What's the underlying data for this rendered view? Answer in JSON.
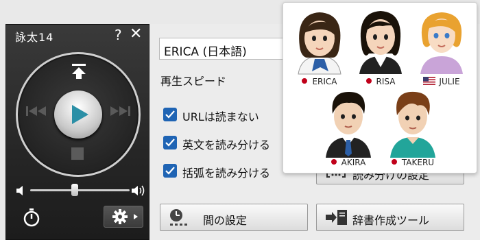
{
  "player": {
    "title": "詠太14",
    "help": "?",
    "close": "✕",
    "icons": [
      "go-to-top-icon",
      "previous-icon",
      "play-icon",
      "next-icon",
      "stop-icon",
      "volume-low-icon",
      "volume-high-icon",
      "timer-icon",
      "gear-icon"
    ],
    "volume_level": 0.45
  },
  "settings": {
    "voice_selected": "ERICA (日本語)",
    "speed_label": "再生スピード",
    "checkboxes": [
      {
        "label": "URLは読まない",
        "checked": true
      },
      {
        "label": "英文を読み分ける",
        "checked": true
      },
      {
        "label": "括弧を読み分ける",
        "checked": true
      }
    ],
    "pause_button": "間の設定",
    "dict_button": "辞書作成ツール",
    "split_button": "読み分けの設定"
  },
  "voice_popup": {
    "voices": [
      {
        "name": "ERICA",
        "marker": "red-dot"
      },
      {
        "name": "RISA",
        "marker": "red-dot"
      },
      {
        "name": "JULIE",
        "marker": "us-flag"
      },
      {
        "name": "AKIRA",
        "marker": "red-dot"
      },
      {
        "name": "TAKERU",
        "marker": "red-dot"
      }
    ]
  },
  "colors": {
    "accent_blue": "#1f64b4",
    "play_teal": "#2b8fa6",
    "marker_red": "#c0001a"
  }
}
